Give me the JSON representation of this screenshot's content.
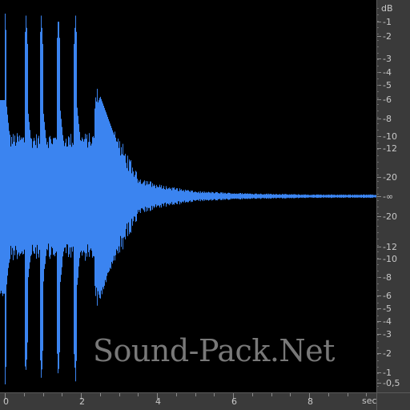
{
  "app": {
    "view": "waveform"
  },
  "colors": {
    "background": "#000000",
    "waveform": "#3b84f0",
    "ruler_bg": "#3a3a3a",
    "ruler_text": "#c8c8c8"
  },
  "rulers": {
    "db_unit": "dB",
    "time_unit": "sec",
    "db_labels_upper": [
      "-1",
      "-2",
      "-3",
      "-4",
      "-5",
      "-6",
      "-8",
      "-10",
      "-12",
      "-20"
    ],
    "db_center_label": "-∞",
    "db_labels_lower": [
      "-20",
      "-12",
      "-10",
      "-8",
      "-6",
      "-5",
      "-4",
      "-3",
      "-2",
      "-1",
      "-0,5"
    ],
    "time_labels": [
      "0",
      "2",
      "4",
      "6",
      "8"
    ]
  },
  "watermark": {
    "text": "Sound-Pack.Net"
  },
  "chart_data": {
    "type": "area",
    "description_kind": "audio waveform",
    "x_unit": "sec",
    "xlim": [
      0,
      9.9
    ],
    "ylim": [
      -1,
      1
    ],
    "strikes_sec": [
      0.0,
      0.55,
      0.95,
      1.4,
      1.85,
      2.4
    ],
    "peak_envelope": [
      {
        "t": 0.0,
        "amp": 0.98
      },
      {
        "t": 0.5,
        "amp": 0.9
      },
      {
        "t": 1.0,
        "amp": 0.95
      },
      {
        "t": 1.5,
        "amp": 0.9
      },
      {
        "t": 2.0,
        "amp": 0.98
      },
      {
        "t": 2.5,
        "amp": 0.58
      },
      {
        "t": 3.0,
        "amp": 0.35
      },
      {
        "t": 3.5,
        "amp": 0.12
      },
      {
        "t": 4.0,
        "amp": 0.07
      },
      {
        "t": 5.0,
        "amp": 0.03
      },
      {
        "t": 6.0,
        "amp": 0.02
      },
      {
        "t": 8.0,
        "amp": 0.01
      },
      {
        "t": 9.9,
        "amp": 0.01
      }
    ]
  }
}
